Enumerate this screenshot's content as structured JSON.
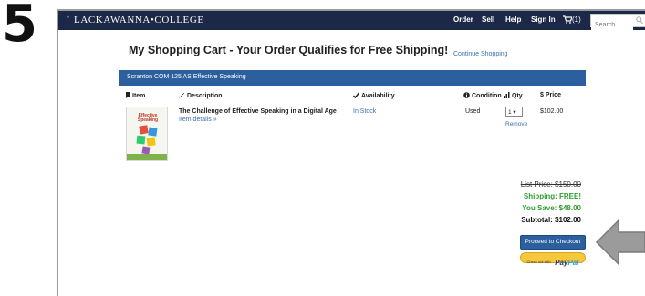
{
  "step_number": "5",
  "header": {
    "logo_text": "LACKAWANNA•COLLEGE",
    "nav": {
      "order": "Order",
      "sell": "Sell",
      "help": "Help",
      "sign_in": "Sign In",
      "cart_count": "(1)"
    },
    "search_placeholder": "Search"
  },
  "cart": {
    "title": "My Shopping Cart - Your Order Qualifies for Free Shipping!",
    "continue_shopping": "Continue Shopping",
    "course_bar": "Scranton  COM  125  AS  Effective Speaking",
    "columns": {
      "item": "Item",
      "description": "Description",
      "availability": "Availability",
      "condition": "Condition",
      "qty": "Qty",
      "price": "Price"
    },
    "line_item": {
      "cover_title": "Effective Speaking",
      "title": "The Challenge of Effective Speaking in a Digital Age",
      "item_details": "Item details »",
      "availability": "In Stock",
      "condition": "Used",
      "qty": "1 ▾",
      "remove": "Remove",
      "price": "$102.00"
    }
  },
  "totals": {
    "list_price": "List Price: $150.00",
    "shipping": "Shipping: FREE!",
    "you_save": "You Save: $48.00",
    "subtotal": "Subtotal: $102.00"
  },
  "buttons": {
    "checkout": "Proceed to Checkout",
    "paypal_prefix": "Check out with",
    "paypal_a": "Pay",
    "paypal_b": "Pal"
  },
  "colors": {
    "nav_bg": "#1c2847",
    "accent_blue": "#2b5f9e",
    "link_blue": "#3a6fb0",
    "success_green": "#2ea02e"
  }
}
